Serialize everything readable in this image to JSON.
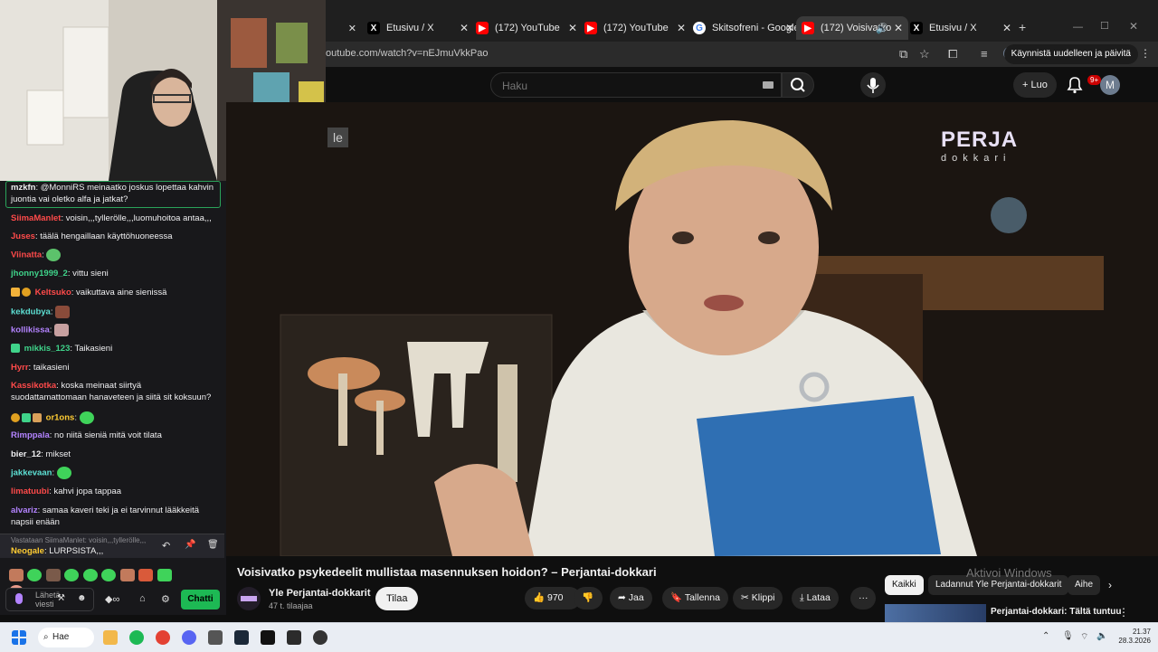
{
  "browser": {
    "tabs": [
      {
        "title": "Etusivu / X",
        "icon": "x-icon",
        "color": "#000000"
      },
      {
        "title": "(172) YouTube",
        "icon": "youtube-icon",
        "color": "#ff0000"
      },
      {
        "title": "(172) YouTube",
        "icon": "youtube-icon",
        "color": "#ff0000"
      },
      {
        "title": "Skitsofreni - Google",
        "icon": "google-icon",
        "color": "#4285f4"
      },
      {
        "title": "(172) Voisivatko",
        "icon": "youtube-icon",
        "color": "#ff0000"
      },
      {
        "title": "Etusivu / X",
        "icon": "x-icon",
        "color": "#000000"
      }
    ],
    "url": "outube.com/watch?v=nEJmuVkkPao",
    "restart_label": "Käynnistä uudelleen ja päivitä",
    "profile_initial": "M"
  },
  "youtube": {
    "search_placeholder": "Haku",
    "create_label": "+ Luo",
    "notifications_badge": "9+",
    "avatar_initial": "M"
  },
  "video": {
    "logo_line1": "PERJA",
    "logo_line2": "dokkari",
    "overlay_fragment": "le",
    "title": "Voisivatko psykedeelit mullistaa masennuksen hoidon? – Perjantai-dokkari",
    "channel": "Yle Perjantai-dokkarit",
    "subscribers": "47 t. tilaajaa",
    "subscribe_label": "Tilaa",
    "likes": "970",
    "share_label": "Jaa",
    "save_label": "Tallenna",
    "clip_label": "Klippi",
    "download_label": "Lataa",
    "more_label": "···"
  },
  "recommendations": {
    "chips": [
      "Kaikki",
      "Ladannut Yle Perjantai-dokkarit",
      "Aihe"
    ],
    "first_title": "Perjantai-dokkari: Tältä tuntuu"
  },
  "overlay": {
    "windows_activation": "Aktivoi Windows"
  },
  "chat": {
    "messages": [
      {
        "user": "mzkfn",
        "color": "#ffffff",
        "text": ": @MonniRS meinaatko joskus lopettaa kahvin juontia vai oletko alfa ja jatkat?"
      },
      {
        "user": "SiimaManlet",
        "color": "#ff4a4a",
        "text": ": voisin,,,tyllerölle,,,luomuhoitoa antaa,,,"
      },
      {
        "user": "Juses",
        "color": "#ff4a4a",
        "text": ": täälä hengaillaan käyttöhuoneessa"
      },
      {
        "user": "Viinatta",
        "color": "#ff4a4a",
        "text": ":"
      },
      {
        "user": "jhonny1999_2",
        "color": "#3fd38a",
        "text": ": vittu sieni"
      },
      {
        "user": "Keltsuko",
        "color": "#ff4a4a",
        "text": ": vaikuttava aine sienissä"
      },
      {
        "user": "kekdubya",
        "color": "#5de0d4",
        "text": ":"
      },
      {
        "user": "kollikissa",
        "color": "#b383ff",
        "text": ":"
      },
      {
        "user": "mikkis_123",
        "color": "#3fd38a",
        "text": ": Taikasieni"
      },
      {
        "user": "Hyrr",
        "color": "#ff4a4a",
        "text": ": taikasieni"
      },
      {
        "user": "Kassikotka",
        "color": "#ff4a4a",
        "text": ": koska meinaat siirtyä suodattamattomaan hanaveteen ja siitä sit koksuun?"
      },
      {
        "user": "or1ons",
        "color": "#ffcc33",
        "text": ":"
      },
      {
        "user": "Rimppala",
        "color": "#b383ff",
        "text": ": no niitä sieniä mitä voit tilata"
      },
      {
        "user": "bier_12",
        "color": "#ffffff",
        "text": ": mikset"
      },
      {
        "user": "jakkevaan",
        "color": "#5de0d4",
        "text": ":"
      },
      {
        "user": "limatuubi",
        "color": "#ff4a4a",
        "text": ": kahvi jopa tappaa"
      },
      {
        "user": "alvariz",
        "color": "#b383ff",
        "text": ": samaa kaveri teki ja ei tarvinnut lääkkeitä napsii enään"
      }
    ],
    "reply_context": "Vastataan SiimaManlet: voisin,,,tyllerölle,,,",
    "pinned_user": "Neogale",
    "pinned_text": ": LURPSISTA,,,",
    "input_placeholder": "Lähetä viesti",
    "send_label": "Chatti"
  },
  "taskbar": {
    "search_label": "Hae",
    "time": "21.37",
    "date": "28.3.2026"
  }
}
